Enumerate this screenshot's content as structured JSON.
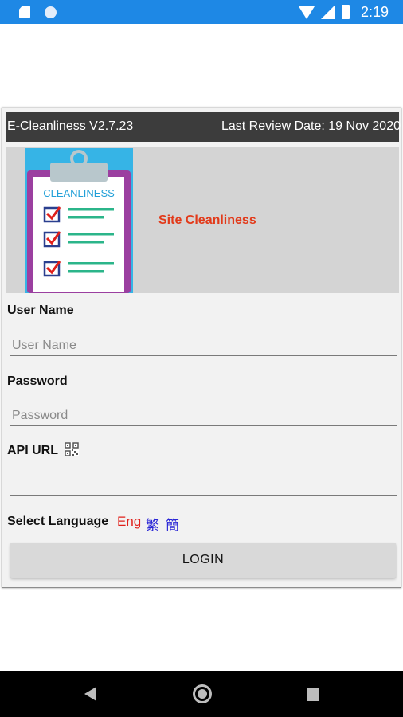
{
  "status_bar": {
    "time": "2:19",
    "icons": [
      "sd-card-icon",
      "notification-dot-icon",
      "wifi-icon",
      "signal-icon",
      "battery-icon"
    ]
  },
  "app": {
    "version_label": "E-Cleanliness V2.7.23",
    "review_date_label": "Last Review Date: 19 Nov 2020",
    "banner": {
      "logo_text": "CLEANLINESS",
      "site_title": "Site Cleanliness"
    },
    "form": {
      "username_label": "User Name",
      "username_placeholder": "User Name",
      "username_value": "",
      "password_label": "Password",
      "password_placeholder": "Password",
      "password_value": "",
      "api_url_label": "API URL",
      "api_url_value": "",
      "language_label": "Select Language",
      "languages": [
        "Eng",
        "繁",
        "簡"
      ],
      "login_label": "LOGIN"
    }
  },
  "colors": {
    "status_bar": "#1e88e5",
    "title_bar": "#3c3c3c",
    "site_title": "#e23a1a",
    "lang_selected": "#e0201b",
    "lang_other": "#2b27d6"
  }
}
